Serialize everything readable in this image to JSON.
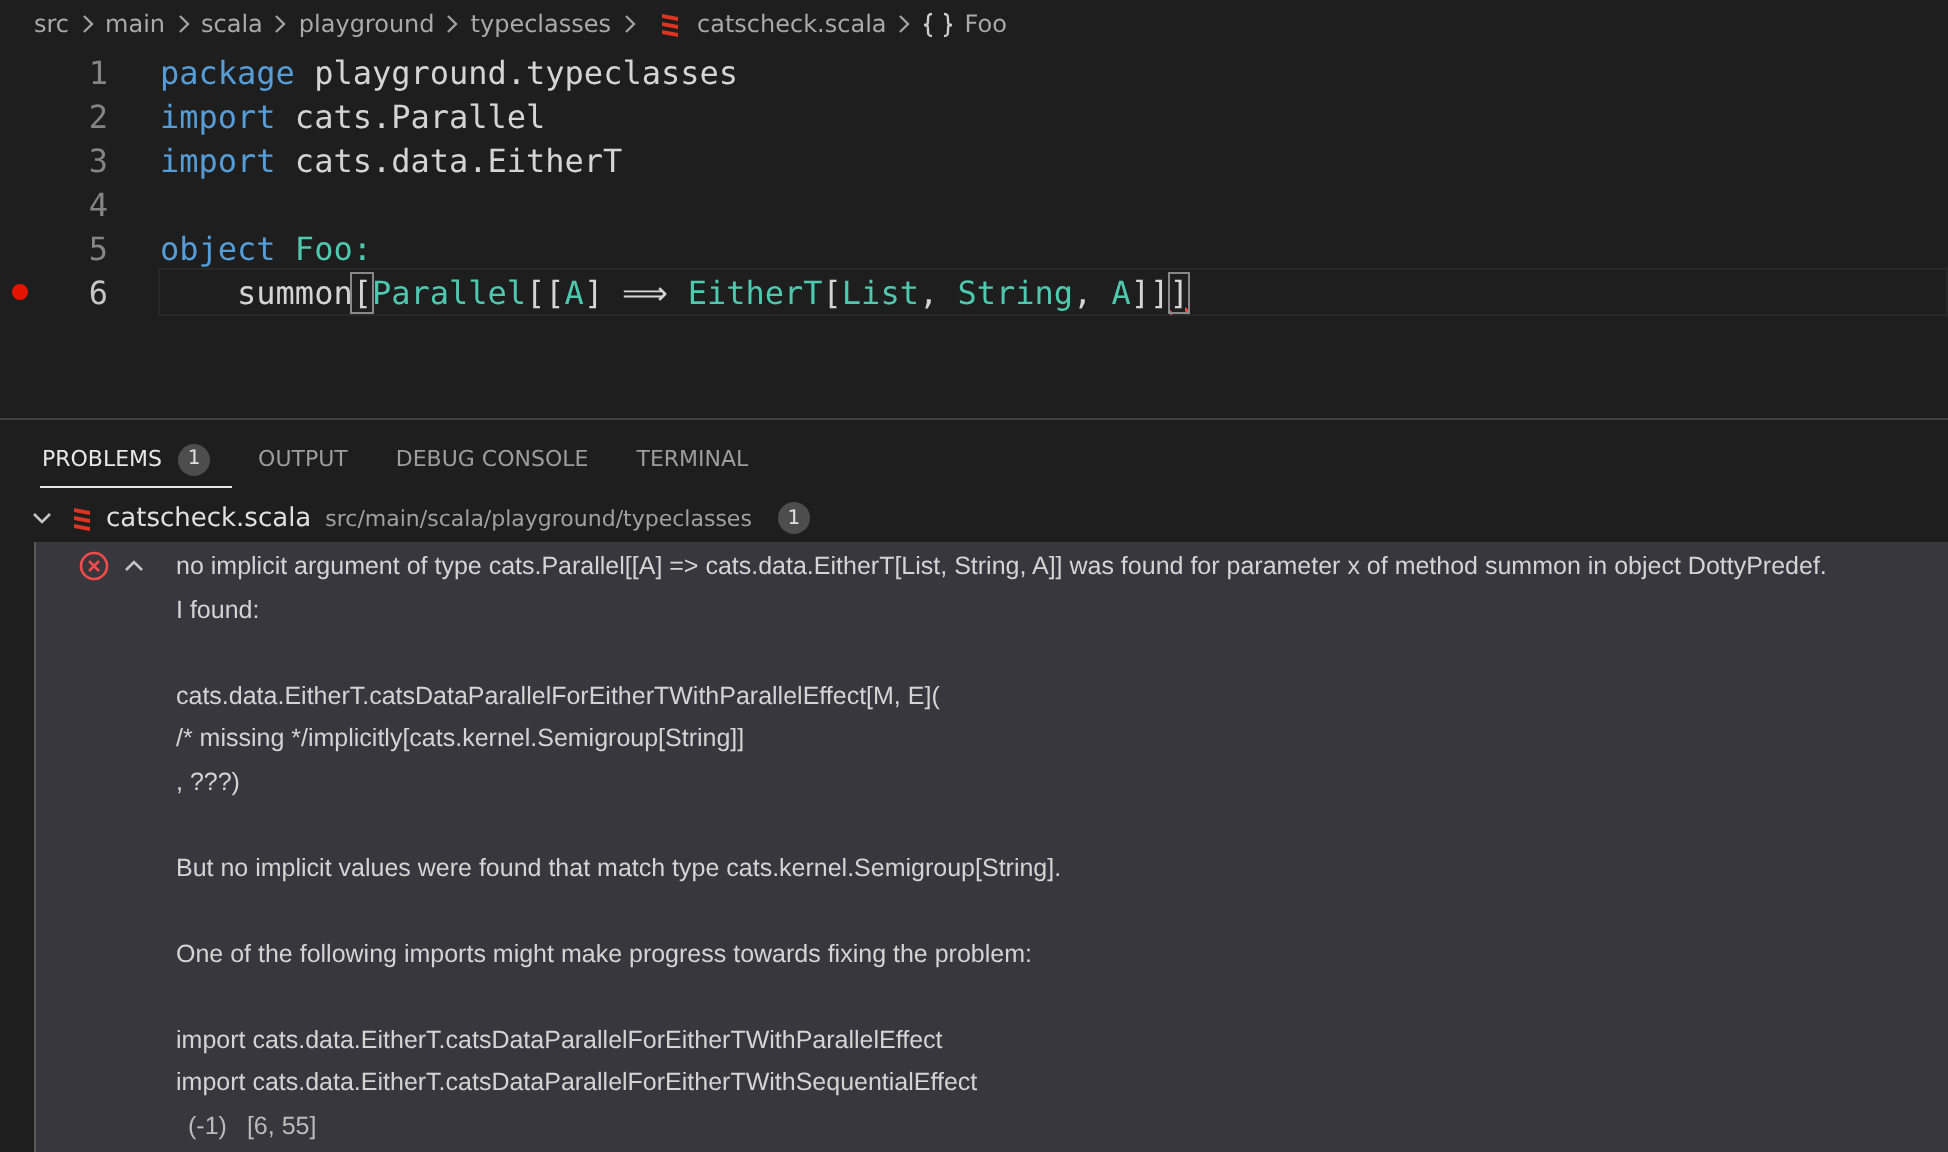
{
  "breadcrumb": {
    "folders": [
      "src",
      "main",
      "scala",
      "playground",
      "typeclasses"
    ],
    "file": "catscheck.scala",
    "symbol": "Foo"
  },
  "editor": {
    "lines": [
      {
        "number": "1",
        "breakpoint": false,
        "current": false,
        "tokens": [
          {
            "text": "package",
            "kind": "keyword"
          },
          {
            "text": " playground.typeclasses",
            "kind": "plain"
          }
        ]
      },
      {
        "number": "2",
        "breakpoint": false,
        "current": false,
        "tokens": [
          {
            "text": "import",
            "kind": "keyword"
          },
          {
            "text": " cats.Parallel",
            "kind": "plain"
          }
        ]
      },
      {
        "number": "3",
        "breakpoint": false,
        "current": false,
        "tokens": [
          {
            "text": "import",
            "kind": "keyword"
          },
          {
            "text": " cats.data.EitherT",
            "kind": "plain"
          }
        ]
      },
      {
        "number": "4",
        "breakpoint": false,
        "current": false
      },
      {
        "number": "5",
        "breakpoint": false,
        "current": false,
        "tokens": [
          {
            "text": "object",
            "kind": "keyword"
          },
          {
            "text": " Foo:",
            "kind": "type"
          }
        ]
      },
      {
        "number": "6",
        "breakpoint": true,
        "current": true,
        "tokens": [
          {
            "text": "    summon",
            "kind": "plain"
          },
          {
            "text": "[",
            "kind": "match"
          },
          {
            "text": "Parallel",
            "kind": "type"
          },
          {
            "text": "[[",
            "kind": "plain"
          },
          {
            "text": "A",
            "kind": "type"
          },
          {
            "text": "] ⟹ ",
            "kind": "plain"
          },
          {
            "text": "EitherT",
            "kind": "type"
          },
          {
            "text": "[",
            "kind": "plain"
          },
          {
            "text": "List",
            "kind": "type"
          },
          {
            "text": ", ",
            "kind": "plain"
          },
          {
            "text": "String",
            "kind": "type"
          },
          {
            "text": ", ",
            "kind": "plain"
          },
          {
            "text": "A",
            "kind": "type"
          },
          {
            "text": "]]",
            "kind": "plain"
          },
          {
            "text": "]",
            "kind": "error"
          }
        ]
      }
    ]
  },
  "panel": {
    "tabs": [
      {
        "label": "PROBLEMS",
        "badge": "1",
        "selected": true
      },
      {
        "label": "OUTPUT",
        "selected": false
      },
      {
        "label": "DEBUG CONSOLE",
        "selected": false
      },
      {
        "label": "TERMINAL",
        "selected": false
      }
    ],
    "file_group": {
      "expanded": true,
      "name": "catscheck.scala",
      "path": "src/main/scala/playground/typeclasses",
      "count": "1"
    },
    "problem": {
      "expanded": true,
      "paragraphs": [
        {
          "lines": [
            "no implicit argument of type cats.Parallel[[A] => cats.data.EitherT[List, String, A]] was found for parameter x of method summon in object DottyPredef.",
            "I found:"
          ]
        },
        {
          "lines": [
            "cats.data.EitherT.catsDataParallelForEitherTWithParallelEffect[M, E](",
            "/* missing */implicitly[cats.kernel.Semigroup[String]]",
            ", ???)"
          ]
        },
        {
          "lines": [
            "But no implicit values were found that match type cats.kernel.Semigroup[String]."
          ]
        },
        {
          "lines": [
            "One of the following imports might make progress towards fixing the problem:"
          ]
        },
        {
          "lines": [
            "import cats.data.EitherT.catsDataParallelForEitherTWithParallelEffect",
            "import cats.data.EitherT.catsDataParallelForEitherTWithSequentialEffect"
          ]
        }
      ],
      "code": "(-1)",
      "position": "[6, 55]"
    }
  }
}
